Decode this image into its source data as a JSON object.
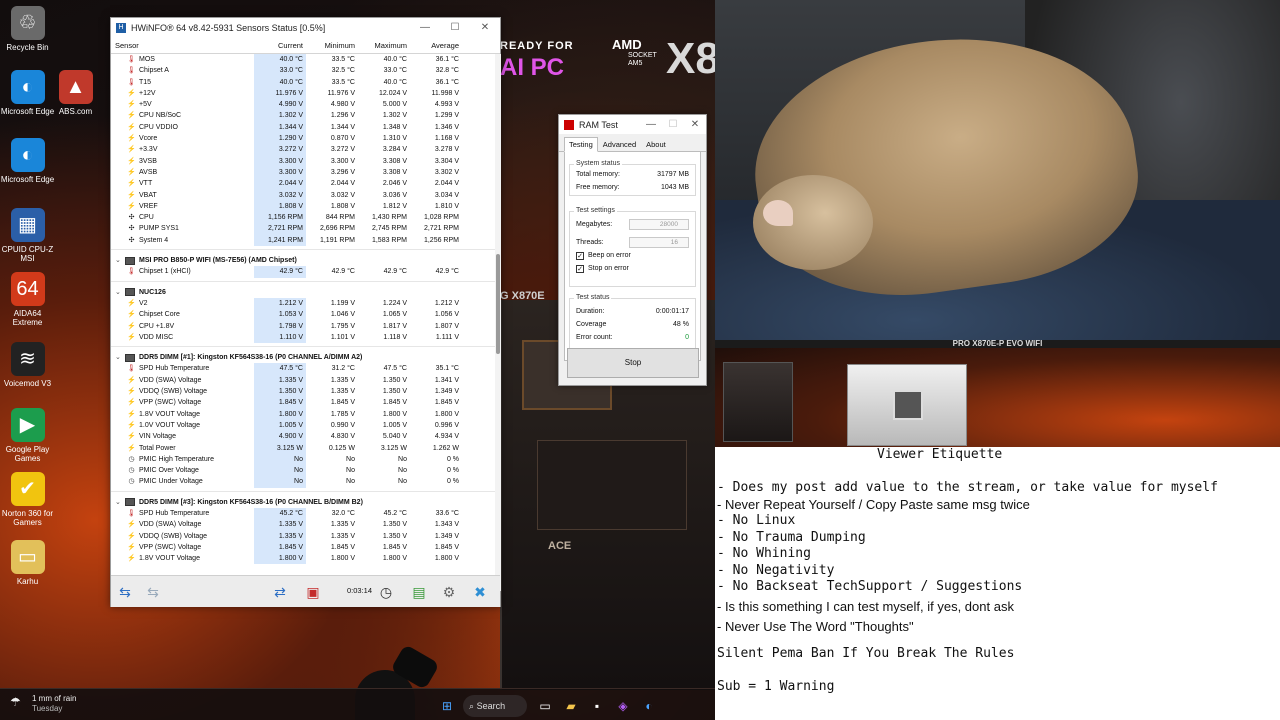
{
  "desktop": {
    "icons": [
      {
        "label": "Recycle Bin",
        "icon": "recycle-bin-icon"
      },
      {
        "label": "Microsoft Edge",
        "icon": "edge-icon"
      },
      {
        "label": "ABS.com",
        "icon": "abs-icon"
      },
      {
        "label": "Microsoft Edge",
        "icon": "edge-icon"
      },
      {
        "label": "CPUID CPU-Z MSI",
        "icon": "cpuz-icon"
      },
      {
        "label": "AIDA64 Extreme",
        "icon": "aida64-icon"
      },
      {
        "label": "Voicemod V3",
        "icon": "voicemod-icon"
      },
      {
        "label": "Google Play Games",
        "icon": "google-play-games-icon"
      },
      {
        "label": "Norton 360 for Gamers",
        "icon": "norton-icon"
      },
      {
        "label": "Karhu",
        "icon": "folder-icon"
      }
    ],
    "banner": {
      "line1": "READY FOR",
      "line2": "AI PC",
      "brand": "AMD",
      "socket": "SOCKET AM5",
      "model": "X8"
    },
    "partials": {
      "g_x870e": "G X870E",
      "ace": "ACE"
    }
  },
  "hwinfo": {
    "title": "HWiNFO® 64 v8.42-5931 Sensors Status [0.5%]",
    "columns": [
      "Sensor",
      "Current",
      "Minimum",
      "Maximum",
      "Average"
    ],
    "groups": [
      {
        "name": "",
        "rows": [
          [
            "MOS",
            "40.0 °C",
            "33.5 °C",
            "40.0 °C",
            "36.1 °C"
          ],
          [
            "Chipset A",
            "33.0 °C",
            "32.5 °C",
            "33.0 °C",
            "32.8 °C"
          ],
          [
            "T15",
            "40.0 °C",
            "33.5 °C",
            "40.0 °C",
            "36.1 °C"
          ],
          [
            "+12V",
            "11.976 V",
            "11.976 V",
            "12.024 V",
            "11.998 V"
          ],
          [
            "+5V",
            "4.990 V",
            "4.980 V",
            "5.000 V",
            "4.993 V"
          ],
          [
            "CPU NB/SoC",
            "1.302 V",
            "1.296 V",
            "1.302 V",
            "1.299 V"
          ],
          [
            "CPU VDDIO",
            "1.344 V",
            "1.344 V",
            "1.348 V",
            "1.346 V"
          ],
          [
            "Vcore",
            "1.290 V",
            "0.870 V",
            "1.310 V",
            "1.168 V"
          ],
          [
            "+3.3V",
            "3.272 V",
            "3.272 V",
            "3.284 V",
            "3.278 V"
          ],
          [
            "3VSB",
            "3.300 V",
            "3.300 V",
            "3.308 V",
            "3.304 V"
          ],
          [
            "AVSB",
            "3.300 V",
            "3.296 V",
            "3.308 V",
            "3.302 V"
          ],
          [
            "VTT",
            "2.044 V",
            "2.044 V",
            "2.046 V",
            "2.044 V"
          ],
          [
            "VBAT",
            "3.032 V",
            "3.032 V",
            "3.036 V",
            "3.034 V"
          ],
          [
            "VREF",
            "1.808 V",
            "1.808 V",
            "1.812 V",
            "1.810 V"
          ],
          [
            "CPU",
            "1,156 RPM",
            "844 RPM",
            "1,430 RPM",
            "1,028 RPM"
          ],
          [
            "PUMP SYS1",
            "2,721 RPM",
            "2,696 RPM",
            "2,745 RPM",
            "2,721 RPM"
          ],
          [
            "System 4",
            "1,241 RPM",
            "1,191 RPM",
            "1,583 RPM",
            "1,256 RPM"
          ]
        ]
      },
      {
        "name": "MSI PRO B850-P WIFI (MS-7E56) (AMD Chipset)",
        "rows": [
          [
            "Chipset 1 (xHCI)",
            "42.9 °C",
            "42.9 °C",
            "42.9 °C",
            "42.9 °C"
          ]
        ]
      },
      {
        "name": "NUC126",
        "rows": [
          [
            "V2",
            "1.212 V",
            "1.199 V",
            "1.224 V",
            "1.212 V"
          ],
          [
            "Chipset Core",
            "1.053 V",
            "1.046 V",
            "1.065 V",
            "1.056 V"
          ],
          [
            "CPU +1.8V",
            "1.798 V",
            "1.795 V",
            "1.817 V",
            "1.807 V"
          ],
          [
            "VDD MISC",
            "1.110 V",
            "1.101 V",
            "1.118 V",
            "1.111 V"
          ]
        ]
      },
      {
        "name": "DDR5 DIMM [#1]: Kingston KF564S38-16 (P0 CHANNEL A/DIMM A2)",
        "rows": [
          [
            "SPD Hub Temperature",
            "47.5 °C",
            "31.2 °C",
            "47.5 °C",
            "35.1 °C"
          ],
          [
            "VDD (SWA) Voltage",
            "1.335 V",
            "1.335 V",
            "1.350 V",
            "1.341 V"
          ],
          [
            "VDDQ (SWB) Voltage",
            "1.350 V",
            "1.335 V",
            "1.350 V",
            "1.349 V"
          ],
          [
            "VPP (SWC) Voltage",
            "1.845 V",
            "1.845 V",
            "1.845 V",
            "1.845 V"
          ],
          [
            "1.8V VOUT Voltage",
            "1.800 V",
            "1.785 V",
            "1.800 V",
            "1.800 V"
          ],
          [
            "1.0V VOUT Voltage",
            "1.005 V",
            "0.990 V",
            "1.005 V",
            "0.996 V"
          ],
          [
            "VIN Voltage",
            "4.900 V",
            "4.830 V",
            "5.040 V",
            "4.934 V"
          ],
          [
            "Total Power",
            "3.125 W",
            "0.125 W",
            "3.125 W",
            "1.262 W"
          ],
          [
            "PMIC High Temperature",
            "No",
            "No",
            "No",
            "0 %"
          ],
          [
            "PMIC Over Voltage",
            "No",
            "No",
            "No",
            "0 %"
          ],
          [
            "PMIC Under Voltage",
            "No",
            "No",
            "No",
            "0 %"
          ]
        ]
      },
      {
        "name": "DDR5 DIMM [#3]: Kingston KF564S38-16 (P0 CHANNEL B/DIMM B2)",
        "rows": [
          [
            "SPD Hub Temperature",
            "45.2 °C",
            "32.0 °C",
            "45.2 °C",
            "33.6 °C"
          ],
          [
            "VDD (SWA) Voltage",
            "1.335 V",
            "1.335 V",
            "1.350 V",
            "1.343 V"
          ],
          [
            "VDDQ (SWB) Voltage",
            "1.335 V",
            "1.335 V",
            "1.350 V",
            "1.349 V"
          ],
          [
            "VPP (SWC) Voltage",
            "1.845 V",
            "1.845 V",
            "1.845 V",
            "1.845 V"
          ],
          [
            "1.8V VOUT Voltage",
            "1.800 V",
            "1.800 V",
            "1.800 V",
            "1.800 V"
          ]
        ]
      }
    ],
    "toolbar": {
      "elapsed": "0:03:14"
    }
  },
  "ramtest": {
    "title": "RAM Test",
    "tabs": [
      "Testing",
      "Advanced",
      "About"
    ],
    "system_status": {
      "label": "System status",
      "total_label": "Total memory:",
      "total": "31797 MB",
      "free_label": "Free memory:",
      "free": "1043 MB"
    },
    "settings": {
      "label": "Test settings",
      "mb_label": "Megabytes:",
      "mb": "28000",
      "threads_label": "Threads:",
      "threads": "16",
      "beep": "Beep on error",
      "stop": "Stop on error"
    },
    "test_status": {
      "label": "Test status",
      "dur_label": "Duration:",
      "duration": "0:00:01:17",
      "cov_label": "Coverage",
      "coverage": "48 %",
      "err_label": "Error count:",
      "errors": "0"
    },
    "stop_button": "Stop"
  },
  "taskbar": {
    "weather_line1": "1 mm of rain",
    "weather_line2": "Tuesday",
    "search": "Search"
  },
  "board_caption": "PRO X870E-P EVO WIFI",
  "etiquette": {
    "title": "Viewer Etiquette",
    "lines": [
      "- Does my post add value to the stream, or take value for myself",
      "-  Never Repeat Yourself / Copy Paste same msg twice",
      "-  No Linux",
      "-  No Trauma Dumping",
      "-  No Whining",
      "-  No Negativity",
      "-  No Backseat TechSupport / Suggestions",
      "- Is this something I can test myself, if yes, dont ask",
      "- Never Use The Word \"Thoughts\""
    ],
    "ban": "Silent Pema Ban If You Break The Rules",
    "sub": "Sub = 1 Warning"
  }
}
